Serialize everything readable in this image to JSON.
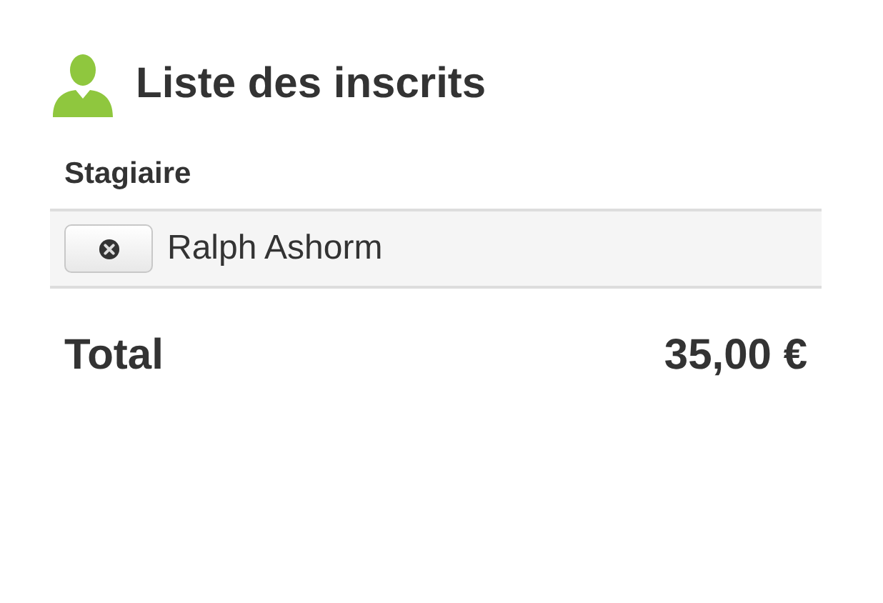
{
  "title": "Liste des inscrits",
  "table": {
    "columns": [
      "Stagiaire"
    ],
    "rows": [
      {
        "name": "Ralph Ashorm"
      }
    ]
  },
  "total": {
    "label": "Total",
    "amount": "35,00 €"
  }
}
